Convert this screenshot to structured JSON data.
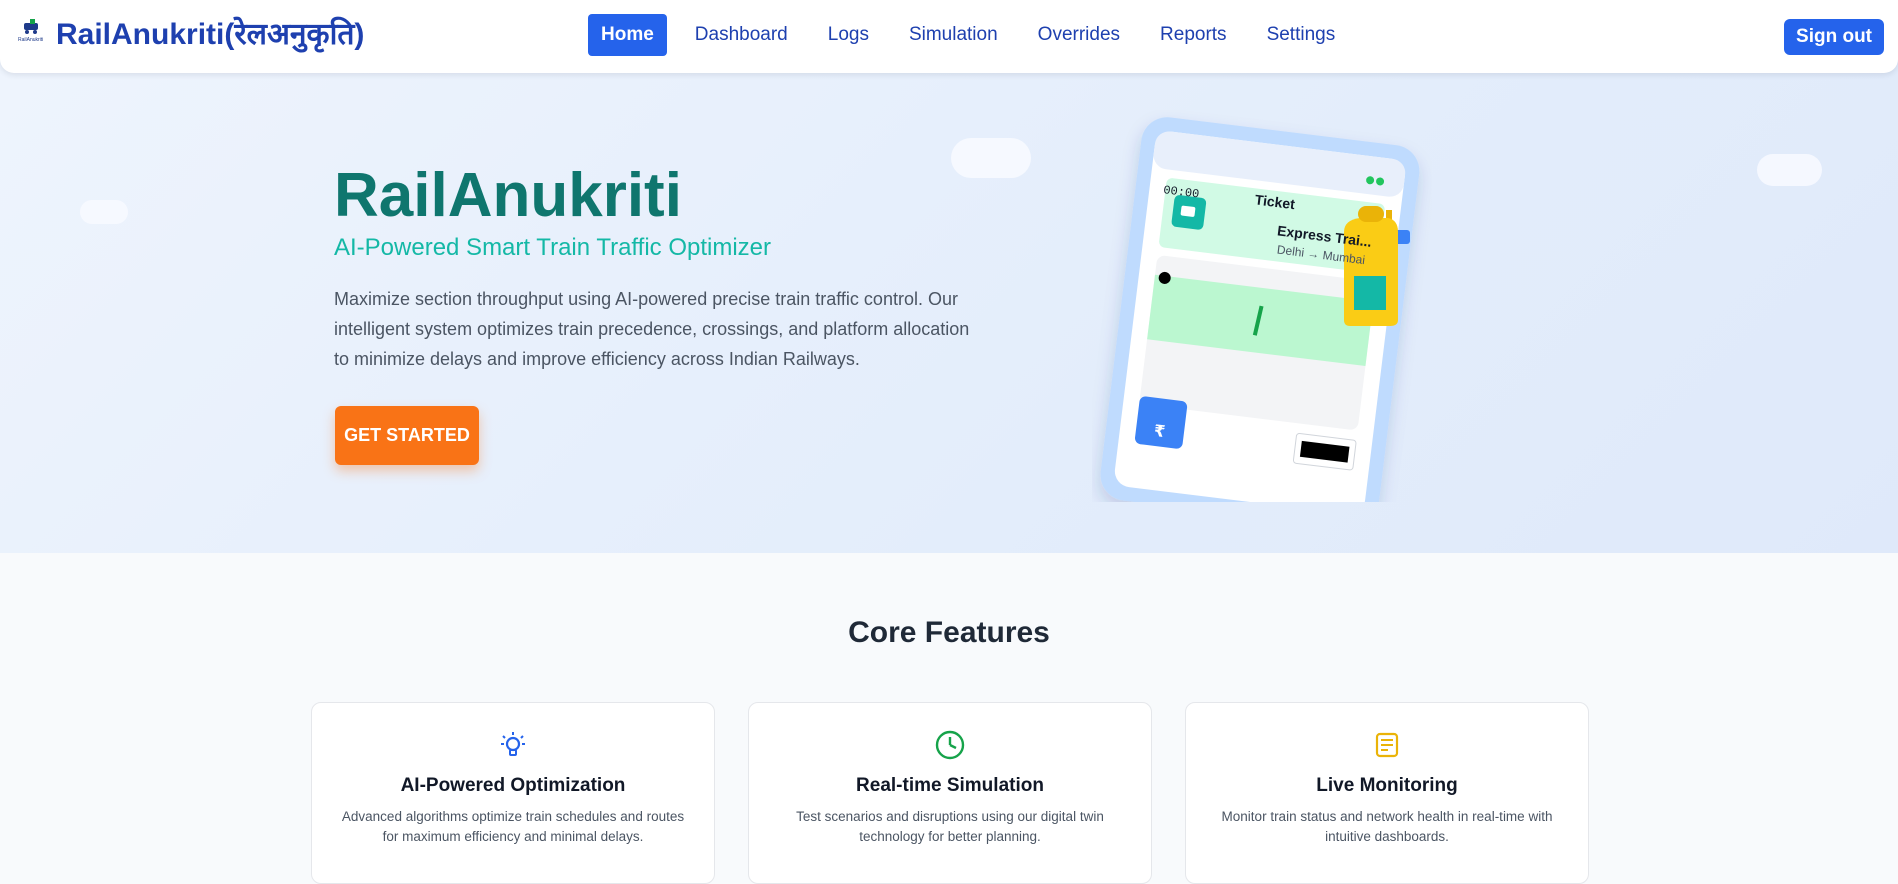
{
  "header": {
    "brand_title": "RailAnukriti(रेलअनुकृति)",
    "logo_caption": "RailAnukriti",
    "nav": [
      "Home",
      "Dashboard",
      "Logs",
      "Simulation",
      "Overrides",
      "Reports",
      "Settings"
    ],
    "sign_out": "Sign out"
  },
  "hero": {
    "title": "RailAnukriti",
    "subtitle": "AI-Powered Smart Train Traffic Optimizer",
    "description": "Maximize section throughput using AI-powered precise train traffic control. Our intelligent system optimizes train precedence, crossings, and platform allocation to minimize delays and improve efficiency across Indian Railways.",
    "cta": "GET STARTED"
  },
  "ticket": {
    "time": "00:00",
    "label": "Ticket",
    "train_name": "Express Trai...",
    "route": "Delhi → Mumbai",
    "currency_symbol": "₹"
  },
  "features_section": {
    "title": "Core Features",
    "items": [
      {
        "icon": "lightbulb-icon",
        "title": "AI-Powered Optimization",
        "desc": "Advanced algorithms optimize train schedules and routes for maximum efficiency and minimal delays."
      },
      {
        "icon": "clock-icon",
        "title": "Real-time Simulation",
        "desc": "Test scenarios and disruptions using our digital twin technology for better planning."
      },
      {
        "icon": "document-icon",
        "title": "Live Monitoring",
        "desc": "Monitor train status and network health in real-time with intuitive dashboards."
      }
    ]
  },
  "colors": {
    "primary": "#2563eb",
    "teal": "#0f766e",
    "accent": "#f97316"
  }
}
